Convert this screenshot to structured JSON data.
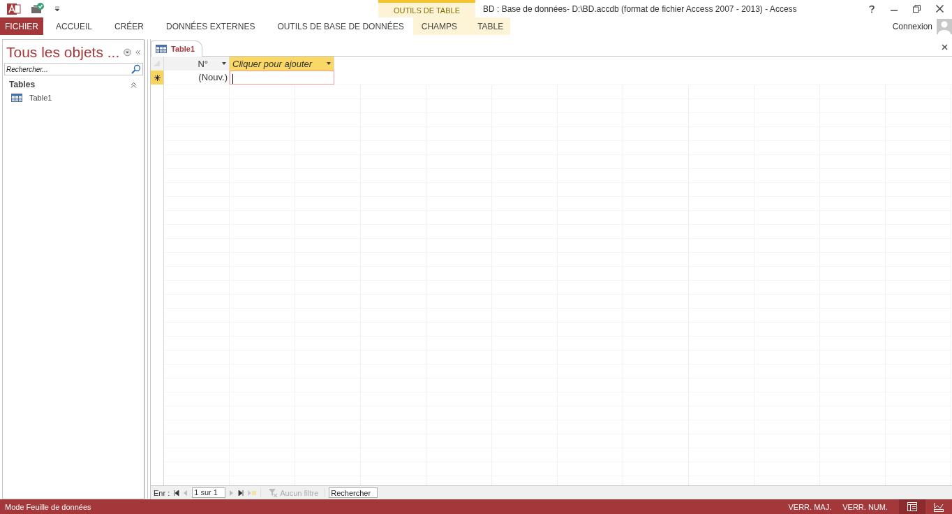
{
  "window": {
    "title": "BD : Base de données- D:\\BD.accdb (format de fichier Access 2007 - 2013) - Access",
    "account": "Connexion"
  },
  "ribbon": {
    "contextual_group": "OUTILS DE TABLE",
    "tabs": [
      {
        "label": "FICHIER",
        "kind": "file",
        "selected": false
      },
      {
        "label": "ACCUEIL",
        "kind": "normal",
        "selected": false
      },
      {
        "label": "CRÉER",
        "kind": "normal",
        "selected": false
      },
      {
        "label": "DONNÉES EXTERNES",
        "kind": "normal",
        "selected": false
      },
      {
        "label": "OUTILS DE BASE DE DONNÉES",
        "kind": "normal",
        "selected": false
      },
      {
        "label": "CHAMPS",
        "kind": "contextual",
        "selected": false
      },
      {
        "label": "TABLE",
        "kind": "contextual",
        "selected": false
      }
    ]
  },
  "nav_pane": {
    "title": "Tous les objets ...",
    "search_placeholder": "Rechercher...",
    "groups": [
      {
        "label": "Tables",
        "expanded": true,
        "items": [
          {
            "label": "Table1"
          }
        ]
      }
    ]
  },
  "document_tabs": [
    {
      "label": "Table1",
      "selected": true
    }
  ],
  "datasheet": {
    "columns": [
      {
        "label": "N°",
        "kind": "field"
      },
      {
        "label": "Cliquer pour ajouter",
        "kind": "add"
      }
    ],
    "new_row": {
      "cells": [
        "(Nouv.)",
        ""
      ]
    }
  },
  "record_nav": {
    "label": "Enr :",
    "position": "1 sur 1",
    "filter": "Aucun filtre",
    "search_placeholder": "Rechercher"
  },
  "status_bar": {
    "mode": "Mode Feuille de données",
    "indicators": [
      "VERR. MAJ.",
      "VERR. NUM."
    ]
  }
}
